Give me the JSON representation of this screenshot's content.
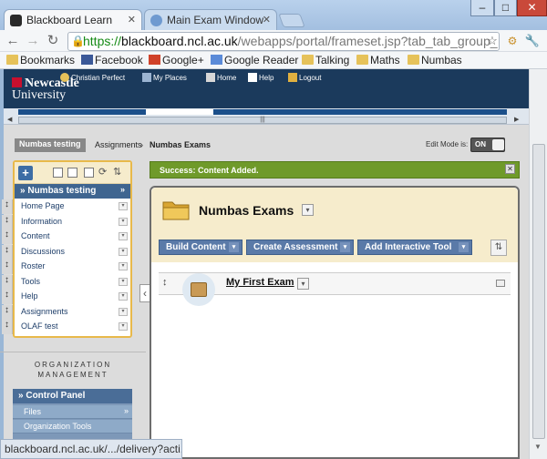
{
  "browser": {
    "tabs": [
      {
        "title": "Blackboard Learn",
        "active": true
      },
      {
        "title": "Main Exam Window",
        "active": false
      }
    ],
    "window_controls": {
      "minimize": "–",
      "maximize": "□",
      "close": "✕"
    },
    "url": {
      "scheme": "https://",
      "host": "blackboard.ncl.ac.uk",
      "path": "/webapps/portal/frameset.jsp?tab_tab_group_"
    },
    "status_url": "blackboard.ncl.ac.uk/.../delivery?acti..."
  },
  "bookmarks": [
    {
      "label": "Bookmarks",
      "icon": "folder-icon"
    },
    {
      "label": "Facebook",
      "icon": "facebook-icon"
    },
    {
      "label": "Google+",
      "icon": "google-plus-icon"
    },
    {
      "label": "Google Reader",
      "icon": "google-reader-icon"
    },
    {
      "label": "Talking",
      "icon": "folder-icon"
    },
    {
      "label": "Maths",
      "icon": "folder-icon"
    },
    {
      "label": "Numbas",
      "icon": "folder-icon"
    }
  ],
  "header": {
    "logo_line1": "Newcastle",
    "logo_line2": "University",
    "user_name": "Christian Perfect",
    "links": [
      "My Places",
      "Home",
      "Help",
      "Logout"
    ]
  },
  "breadcrumb": {
    "course": "Numbas testing",
    "items": [
      "Assignments",
      "Numbas Exams"
    ]
  },
  "edit_mode": {
    "label": "Edit Mode is:",
    "value": "ON"
  },
  "course_menu": {
    "title": "Numbas testing",
    "items": [
      "Home Page",
      "Information",
      "Content",
      "Discussions",
      "Roster",
      "Tools",
      "Help",
      "Assignments",
      "OLAF test"
    ]
  },
  "org_management": {
    "line1": "ORGANIZATION",
    "line2": "MANAGEMENT"
  },
  "control_panel": {
    "title": "Control Panel",
    "items": [
      "Files",
      "Organization Tools"
    ]
  },
  "success_message": "Success: Content Added.",
  "content": {
    "title": "Numbas Exams",
    "actions": [
      "Build Content",
      "Create Assessment",
      "Add Interactive Tool"
    ],
    "items": [
      {
        "title": "My First Exam"
      }
    ]
  },
  "colors": {
    "header_navy": "#1b3a5c",
    "success_green": "#6f9a2a",
    "action_blue": "#5a7aa8",
    "menu_border": "#e8b94a"
  }
}
